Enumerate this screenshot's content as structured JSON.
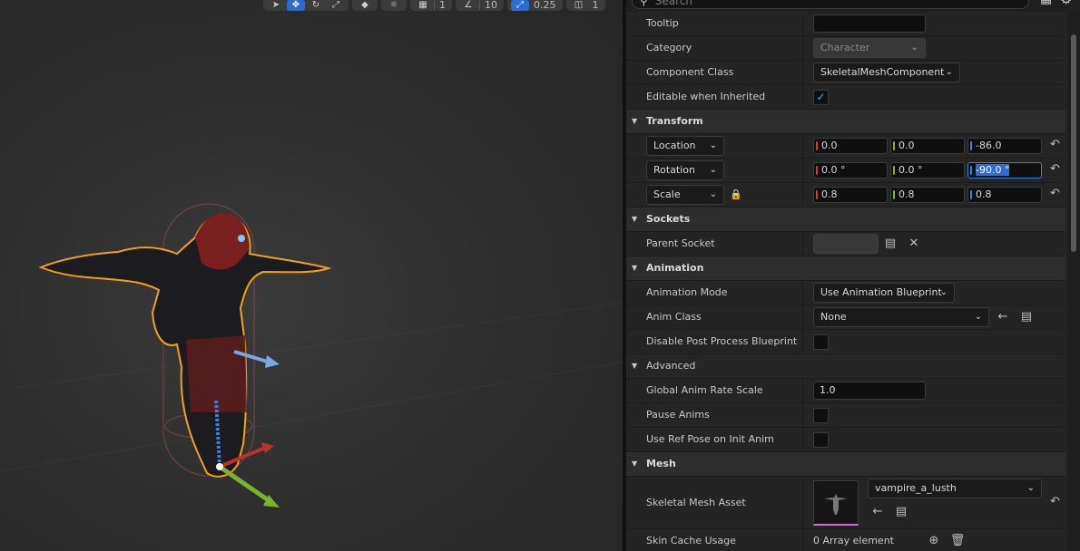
{
  "toolbar": {
    "grid_snap_value": "1",
    "rotation_snap_value": "10",
    "scale_snap_value": "0.25",
    "camera_speed": "1"
  },
  "search": {
    "placeholder": "Search"
  },
  "details": {
    "tooltip_label": "Tooltip",
    "tooltip_value": "",
    "category_label": "Category",
    "category_value": "Character",
    "component_class_label": "Component Class",
    "component_class_value": "SkeletalMeshComponent",
    "editable_inherited_label": "Editable when Inherited",
    "editable_inherited_checked": true,
    "transform": {
      "header": "Transform",
      "location": {
        "mode": "Location",
        "x": "0.0",
        "y": "0.0",
        "z": "-86.0"
      },
      "rotation": {
        "mode": "Rotation",
        "x": "0.0 °",
        "y": "0.0 °",
        "z": "-90.0 °"
      },
      "scale": {
        "mode": "Scale",
        "x": "0.8",
        "y": "0.8",
        "z": "0.8"
      }
    },
    "sockets": {
      "header": "Sockets",
      "parent_socket_label": "Parent Socket",
      "parent_socket_value": ""
    },
    "animation": {
      "header": "Animation",
      "mode_label": "Animation Mode",
      "mode_value": "Use Animation Blueprint",
      "anim_class_label": "Anim Class",
      "anim_class_value": "None",
      "disable_pp_label": "Disable Post Process Blueprint",
      "advanced_header": "Advanced",
      "global_rate_label": "Global Anim Rate Scale",
      "global_rate_value": "1.0",
      "pause_label": "Pause Anims",
      "ref_pose_label": "Use Ref Pose on Init Anim"
    },
    "mesh": {
      "header": "Mesh",
      "skeletal_mesh_label": "Skeletal Mesh Asset",
      "skeletal_mesh_value": "vampire_a_lusth",
      "skin_cache_label": "Skin Cache Usage",
      "skin_cache_value": "0 Array element"
    }
  },
  "colors": {
    "accent_blue": "#2a6bd6",
    "selection_outline": "#f0a020",
    "axis_x": "#d33a3a",
    "axis_y": "#78b53a",
    "axis_z": "#3f7fe0"
  }
}
